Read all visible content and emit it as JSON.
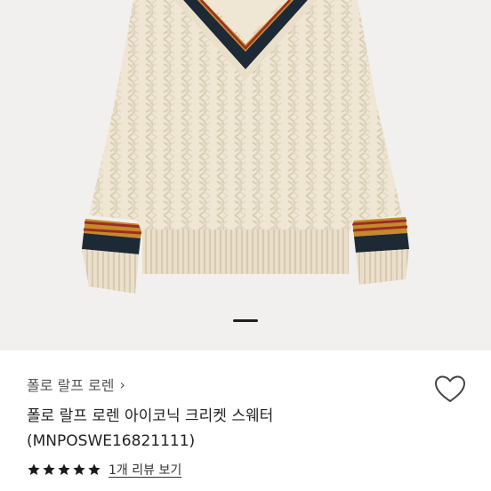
{
  "gallery": {
    "image_alt": "cream cable knit cricket V-neck sweater with navy, red and gold stripe trim",
    "colors": {
      "background": "#f1f0ee",
      "knit": "#efe6d3",
      "navy": "#1d2a36",
      "red": "#9b2f22",
      "gold": "#c68a2a"
    },
    "slide_count": 3,
    "active_slide": 1
  },
  "product": {
    "brand": "폴로 랄프 로렌",
    "brand_chevron": "›",
    "name_line1": "폴로 랄프 로렌 아이코닉 크리켓 스웨터",
    "name_line2": "(MNPOSWE16821111)",
    "rating": 5,
    "review_link": "1개 리뷰 보기",
    "icons": {
      "wishlist": "heart-outline-icon",
      "star": "star-icon",
      "chevron": "chevron-right-icon"
    },
    "star_color": "#1a1a1a"
  }
}
